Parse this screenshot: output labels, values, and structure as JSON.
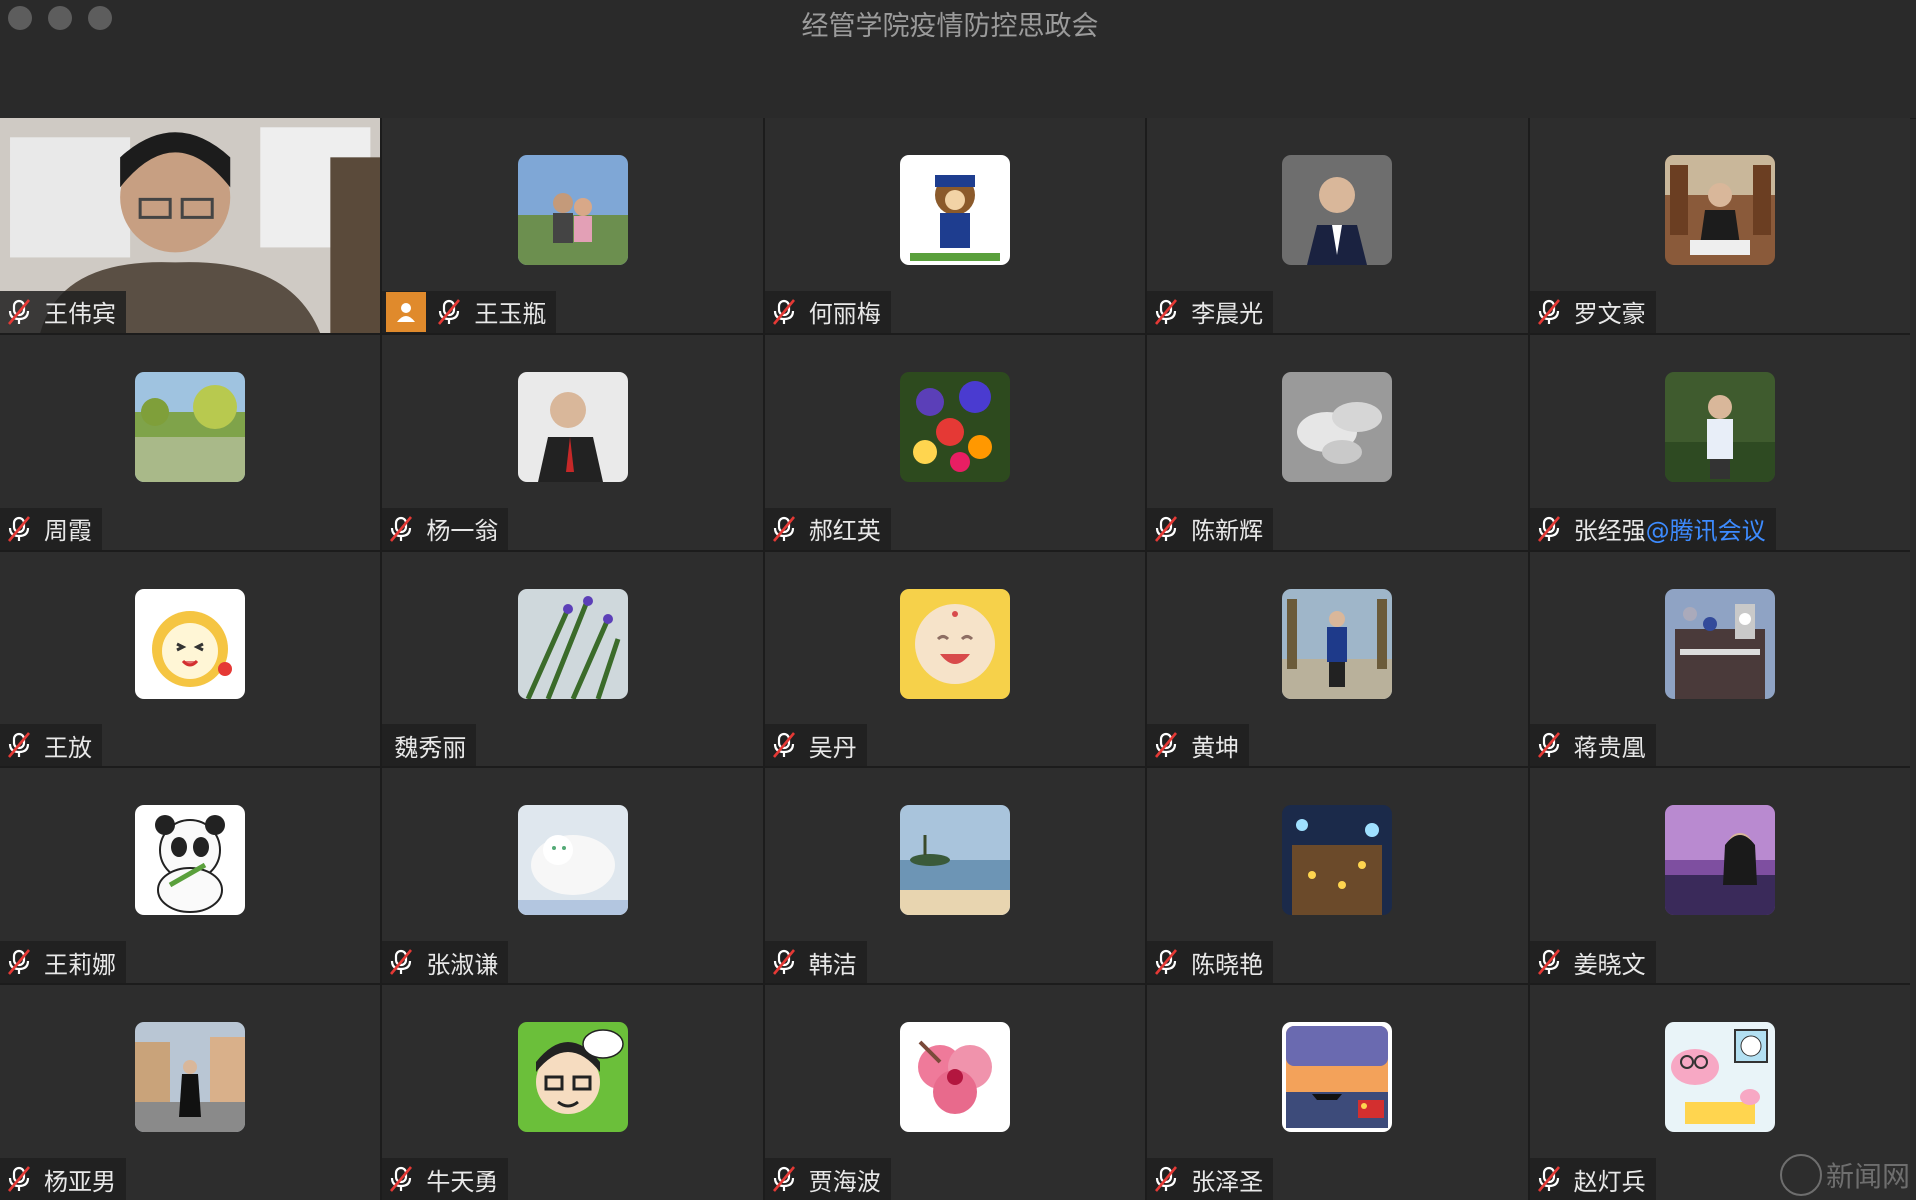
{
  "window": {
    "title": "经管学院疫情防控思政会"
  },
  "participants": [
    {
      "name": "王伟宾",
      "muted": true,
      "video": true
    },
    {
      "name": "王玉瓶",
      "muted": true,
      "host_badge": true,
      "avatar_icon": "photo-two-people"
    },
    {
      "name": "何丽梅",
      "muted": true,
      "avatar_icon": "cartoon-dog"
    },
    {
      "name": "李晨光",
      "muted": true,
      "avatar_icon": "photo-man-suit"
    },
    {
      "name": "罗文豪",
      "muted": true,
      "avatar_icon": "photo-man-library"
    },
    {
      "name": "周霞",
      "muted": true,
      "avatar_icon": "photo-lake-trees"
    },
    {
      "name": "杨一翁",
      "muted": true,
      "avatar_icon": "photo-man-red-tie"
    },
    {
      "name": "郝红英",
      "muted": true,
      "avatar_icon": "photo-flowers"
    },
    {
      "name": "陈新辉",
      "muted": true,
      "avatar_icon": "photo-hands"
    },
    {
      "name": "张经强",
      "org_suffix": "@腾讯会议",
      "muted": true,
      "avatar_icon": "photo-man-garden"
    },
    {
      "name": "王放",
      "muted": true,
      "avatar_icon": "cartoon-cat"
    },
    {
      "name": "魏秀丽",
      "muted": false,
      "avatar_icon": "photo-plants"
    },
    {
      "name": "吴丹",
      "muted": true,
      "avatar_icon": "photo-baby-figurine"
    },
    {
      "name": "黄坤",
      "muted": true,
      "avatar_icon": "photo-man-street"
    },
    {
      "name": "蒋贵凰",
      "muted": true,
      "avatar_icon": "photo-building"
    },
    {
      "name": "王莉娜",
      "muted": true,
      "avatar_icon": "cartoon-panda"
    },
    {
      "name": "张淑谦",
      "muted": true,
      "avatar_icon": "photo-white-cat"
    },
    {
      "name": "韩洁",
      "muted": true,
      "avatar_icon": "photo-beach"
    },
    {
      "name": "陈晓艳",
      "muted": true,
      "avatar_icon": "photo-night-lights"
    },
    {
      "name": "姜晓文",
      "muted": true,
      "avatar_icon": "photo-woman-sunset"
    },
    {
      "name": "杨亚男",
      "muted": true,
      "avatar_icon": "photo-woman-town"
    },
    {
      "name": "牛天勇",
      "muted": true,
      "avatar_icon": "cartoon-boy-glasses"
    },
    {
      "name": "贾海波",
      "muted": true,
      "avatar_icon": "photo-pink-flower"
    },
    {
      "name": "张泽圣",
      "muted": true,
      "avatar_icon": "photo-boat-sunset-flag"
    },
    {
      "name": "赵灯兵",
      "muted": true,
      "avatar_icon": "cartoon-peppa"
    }
  ],
  "watermark": {
    "text": "新闻网"
  }
}
